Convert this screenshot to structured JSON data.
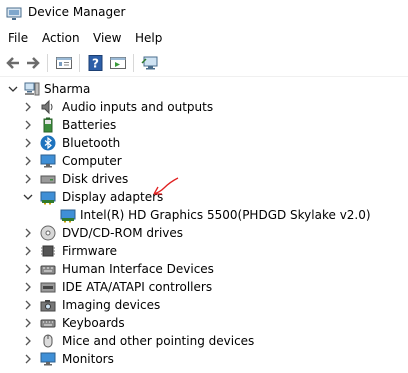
{
  "window": {
    "title": "Device Manager"
  },
  "menu": [
    "File",
    "Action",
    "View",
    "Help"
  ],
  "tree": {
    "root": {
      "label": "Sharma",
      "icon": "computer-icon",
      "expanded": true
    },
    "items": [
      {
        "label": "Audio inputs and outputs",
        "icon": "speaker-icon",
        "expanded": false
      },
      {
        "label": "Batteries",
        "icon": "battery-icon",
        "expanded": false
      },
      {
        "label": "Bluetooth",
        "icon": "bluetooth-icon",
        "expanded": false
      },
      {
        "label": "Computer",
        "icon": "monitor-icon",
        "expanded": false
      },
      {
        "label": "Disk drives",
        "icon": "disk-drive-icon",
        "expanded": false
      },
      {
        "label": "Display adapters",
        "icon": "display-adapter-icon",
        "expanded": true
      },
      {
        "label": "Intel(R) HD Graphics 5500(PHDGD Skylake v2.0)",
        "icon": "display-adapter-icon",
        "child": true
      },
      {
        "label": "DVD/CD-ROM drives",
        "icon": "dvd-icon",
        "expanded": false
      },
      {
        "label": "Firmware",
        "icon": "firmware-icon",
        "expanded": false
      },
      {
        "label": "Human Interface Devices",
        "icon": "hid-icon",
        "expanded": false
      },
      {
        "label": "IDE ATA/ATAPI controllers",
        "icon": "ide-controller-icon",
        "expanded": false
      },
      {
        "label": "Imaging devices",
        "icon": "camera-icon",
        "expanded": false
      },
      {
        "label": "Keyboards",
        "icon": "keyboard-icon",
        "expanded": false
      },
      {
        "label": "Mice and other pointing devices",
        "icon": "mouse-icon",
        "expanded": false
      },
      {
        "label": "Monitors",
        "icon": "monitor-icon",
        "expanded": false
      }
    ]
  },
  "colors": {
    "accent": "#1e73be",
    "annotation": "#e02020",
    "selection": "#cce8ff"
  }
}
